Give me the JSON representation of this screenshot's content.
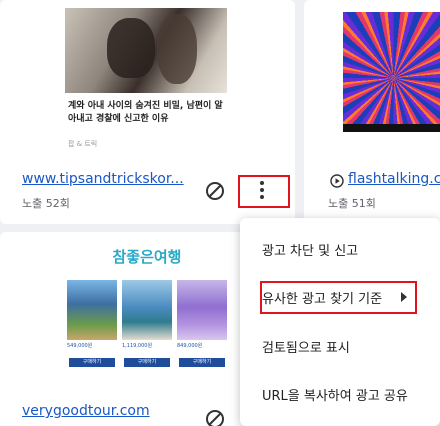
{
  "cards": [
    {
      "ad": {
        "headline": "계와 아내 사이의 숨겨진 비밀, 남편이 알아내고 경찰에 신고한 이유",
        "source": "팝 & 트릭"
      },
      "url": "www.tipsandtrickskor...",
      "impressions": "노출 52회"
    },
    {
      "url": "flashtalking.c",
      "impressions": "노출 51회"
    },
    {
      "ad": {
        "title": "참좋은여행",
        "prices": [
          "549,000원",
          "1,119,000원",
          "849,000원"
        ],
        "button": "구매하기"
      },
      "url": "verygoodtour.com"
    }
  ],
  "menu": {
    "items": [
      "광고 차단 및 신고",
      "유사한 광고 찾기 기준",
      "검토됨으로 표시",
      "URL을 복사하여 광고 공유"
    ]
  },
  "colors": {
    "link": "#1a57c7",
    "highlight": "#e0141e",
    "background": "#eef0f3"
  },
  "icons": [
    "block-icon",
    "more-vert-icon",
    "play-circle-icon",
    "submenu-arrow-icon"
  ]
}
